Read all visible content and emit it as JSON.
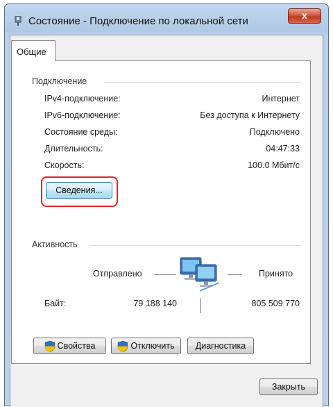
{
  "window": {
    "title": "Состояние - Подключение по локальной сети",
    "close_glyph": "x"
  },
  "tab": {
    "label": "Общие"
  },
  "connection": {
    "group_title": "Подключение",
    "rows": [
      {
        "label": "IPv4-подключение:",
        "value": "Интернет"
      },
      {
        "label": "IPv6-подключение:",
        "value": "Без доступа к Интернету"
      },
      {
        "label": "Состояние среды:",
        "value": "Подключено"
      },
      {
        "label": "Длительность:",
        "value": "04:47:33"
      },
      {
        "label": "Скорость:",
        "value": "100.0 Мбит/с"
      }
    ],
    "details_button": "Сведения..."
  },
  "activity": {
    "group_title": "Активность",
    "sent_label": "Отправлено",
    "received_label": "Принято",
    "bytes_label": "Байт:",
    "bytes_sent": "79 188 140",
    "bytes_received": "805 509 770",
    "icon": "network-computers-icon"
  },
  "buttons": {
    "properties": "Свойства",
    "disable": "Отключить",
    "diagnose": "Диагностика",
    "close": "Закрыть"
  },
  "colors": {
    "highlight": "#e3262d",
    "title_bar": "#b9cfe7",
    "close_button": "#c23a22"
  }
}
